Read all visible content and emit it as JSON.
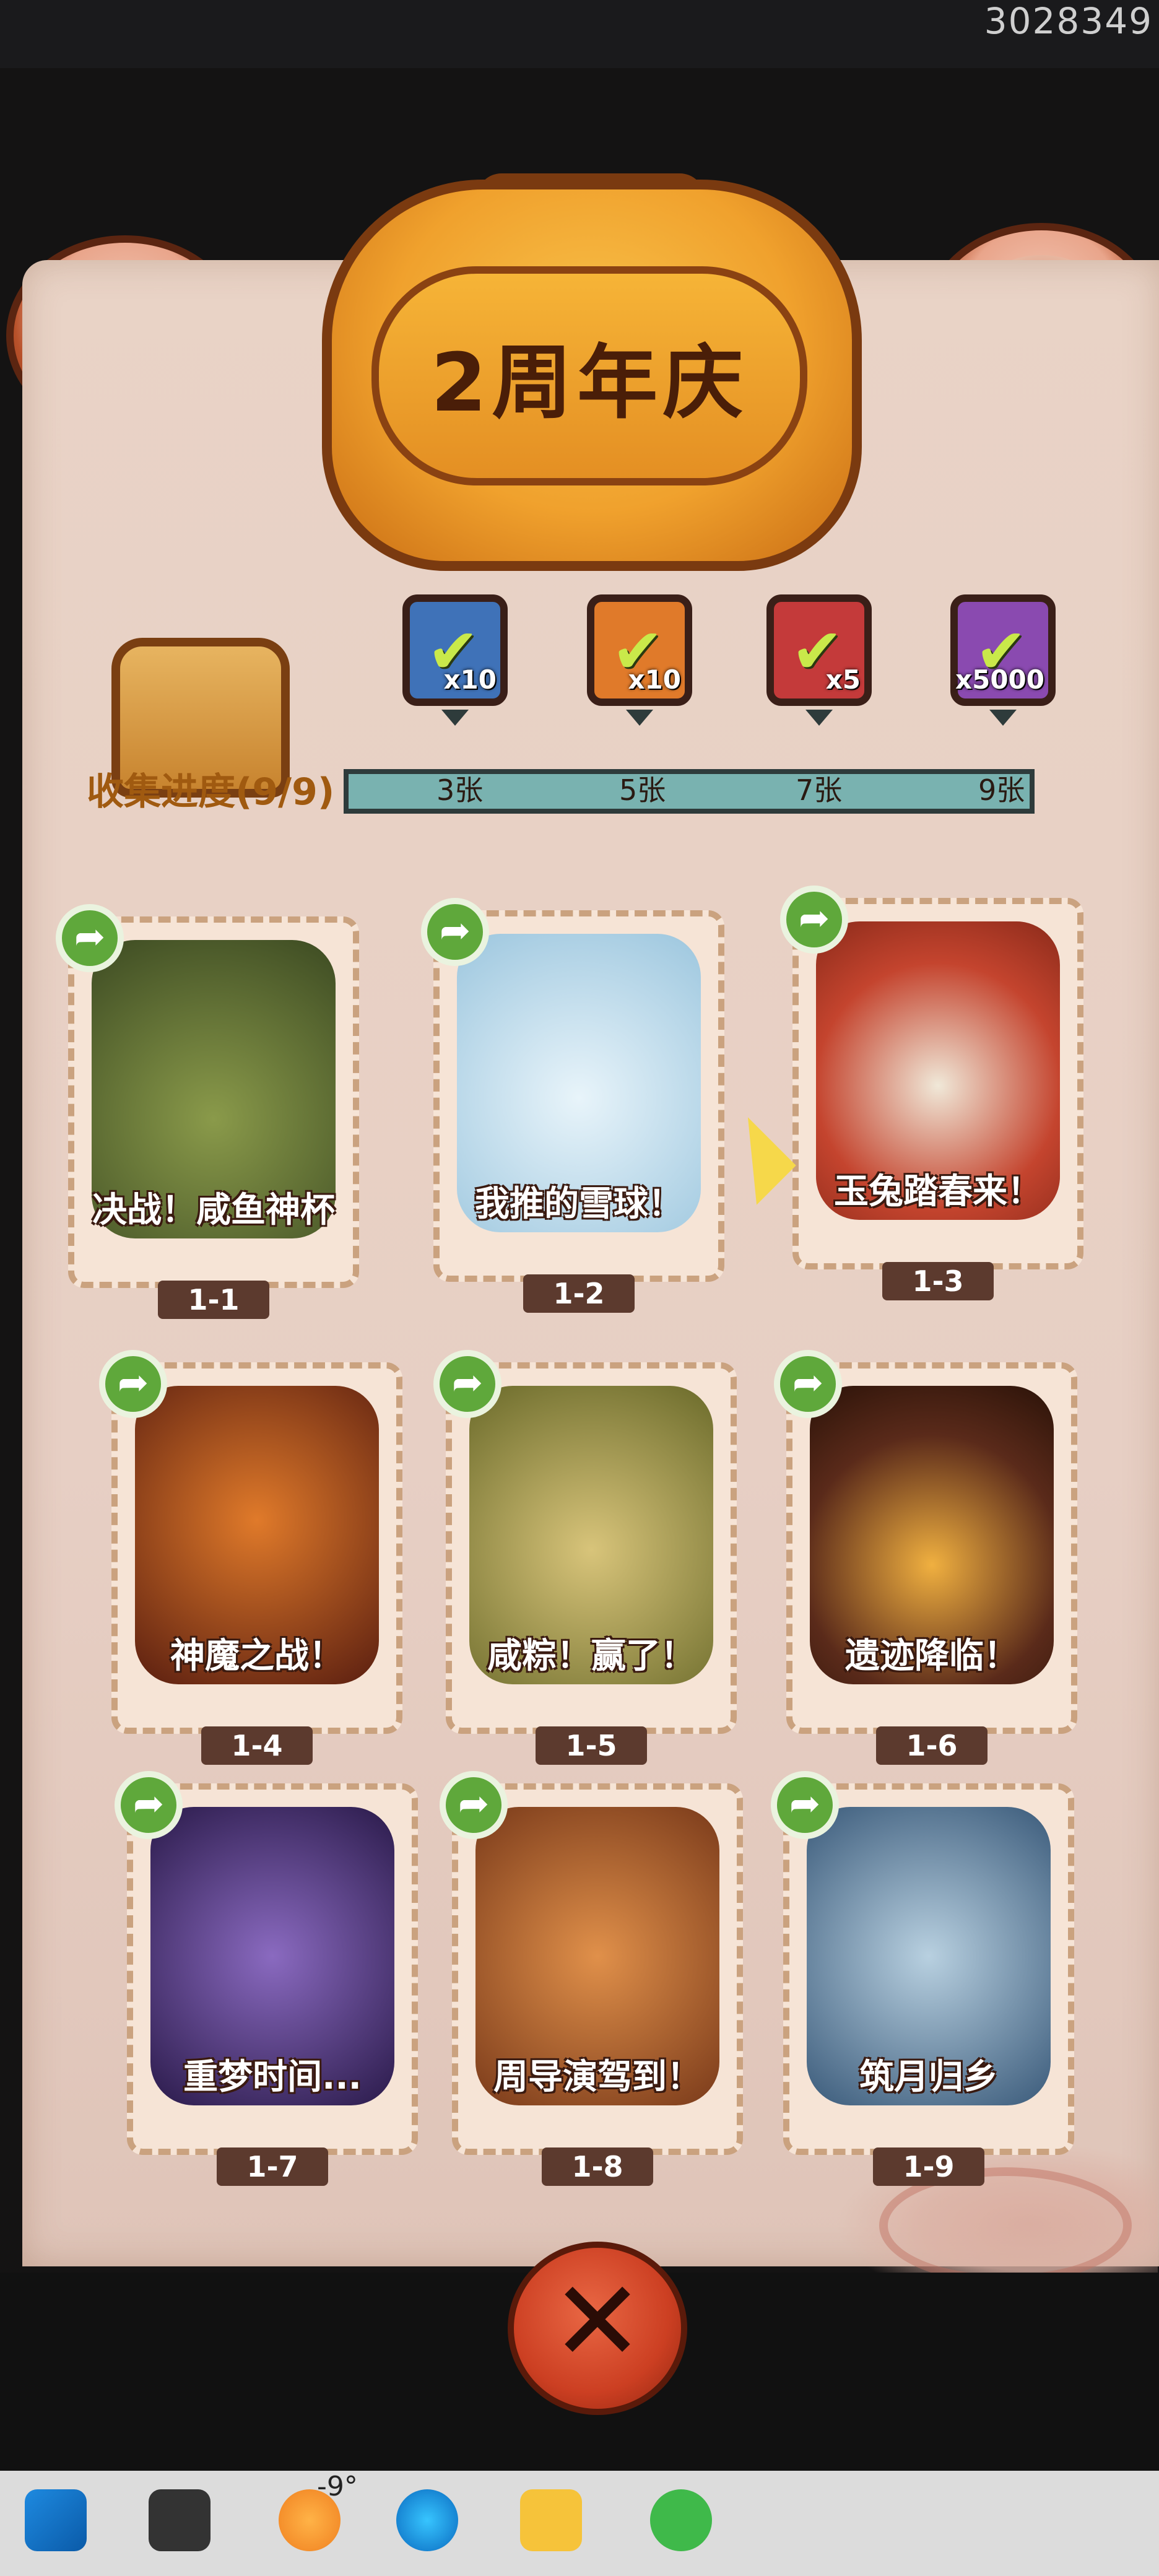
{
  "corner_id": "3028349",
  "banner": {
    "title": "2周年庆"
  },
  "collection": {
    "progress_label": "收集进度(9/9)",
    "rewards": [
      {
        "qty": "x10",
        "threshold": "3张",
        "color": "#3f72b8"
      },
      {
        "qty": "x10",
        "threshold": "5张",
        "color": "#e07a2a"
      },
      {
        "qty": "x5",
        "threshold": "7张",
        "color": "#c43a3a"
      },
      {
        "qty": "x5000",
        "threshold": "9张",
        "color": "#8a4ab0"
      }
    ]
  },
  "cards": [
    {
      "title": "决战！咸鱼神杯",
      "number": "1-1",
      "color": "#5d6b34"
    },
    {
      "title": "我推的雪球！",
      "number": "1-2",
      "color": "#bcdbe8"
    },
    {
      "title": "玉兔踏春来！",
      "number": "1-3",
      "color": "#c4442e"
    },
    {
      "title": "神魔之战！",
      "number": "1-4",
      "color": "#9a3a1e"
    },
    {
      "title": "咸粽！赢了！",
      "number": "1-5",
      "color": "#8a8a3a"
    },
    {
      "title": "遗迹降临！",
      "number": "1-6",
      "color": "#5a2a1a"
    },
    {
      "title": "重梦时间...",
      "number": "1-7",
      "color": "#4a2a6a"
    },
    {
      "title": "周导演驾到！",
      "number": "1-8",
      "color": "#b85a2a"
    },
    {
      "title": "筑月归乡",
      "number": "1-9",
      "color": "#5a7aa0"
    }
  ],
  "taskbar": {
    "temperature": "-9°"
  },
  "icons": [
    "share-icon",
    "close-icon",
    "check-icon",
    "windows-start-icon",
    "weather-icon",
    "edge-icon",
    "wechat-icon"
  ]
}
